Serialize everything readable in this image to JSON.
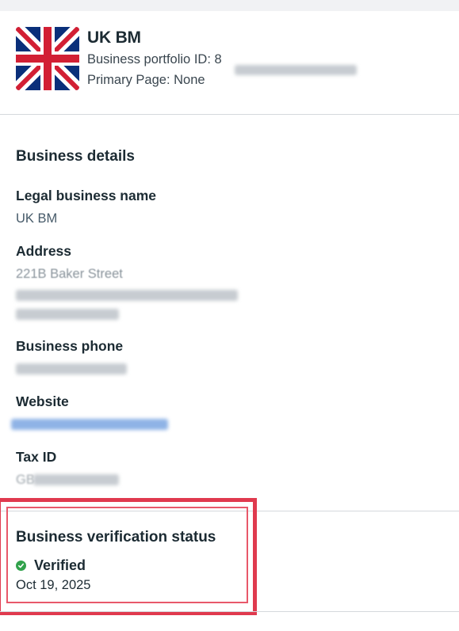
{
  "business": {
    "name": "UK BM",
    "portfolio_id_label": "Business portfolio ID: 8",
    "primary_page_label": "Primary Page: None"
  },
  "details": {
    "section_title": "Business details",
    "legal_name_label": "Legal business name",
    "legal_name_value": "UK BM",
    "address_label": "Address",
    "address_line1": "221B Baker Street",
    "phone_label": "Business phone",
    "website_label": "Website",
    "tax_id_label": "Tax ID",
    "tax_id_prefix": "GB"
  },
  "verification": {
    "section_title": "Business verification status",
    "status": "Verified",
    "date": "Oct 19, 2025"
  },
  "colors": {
    "verified": "#31a24c",
    "highlight": "#e03a4e",
    "link": "#1a6fd1"
  },
  "icons": [
    "uk-flag-icon",
    "check-circle-icon"
  ]
}
